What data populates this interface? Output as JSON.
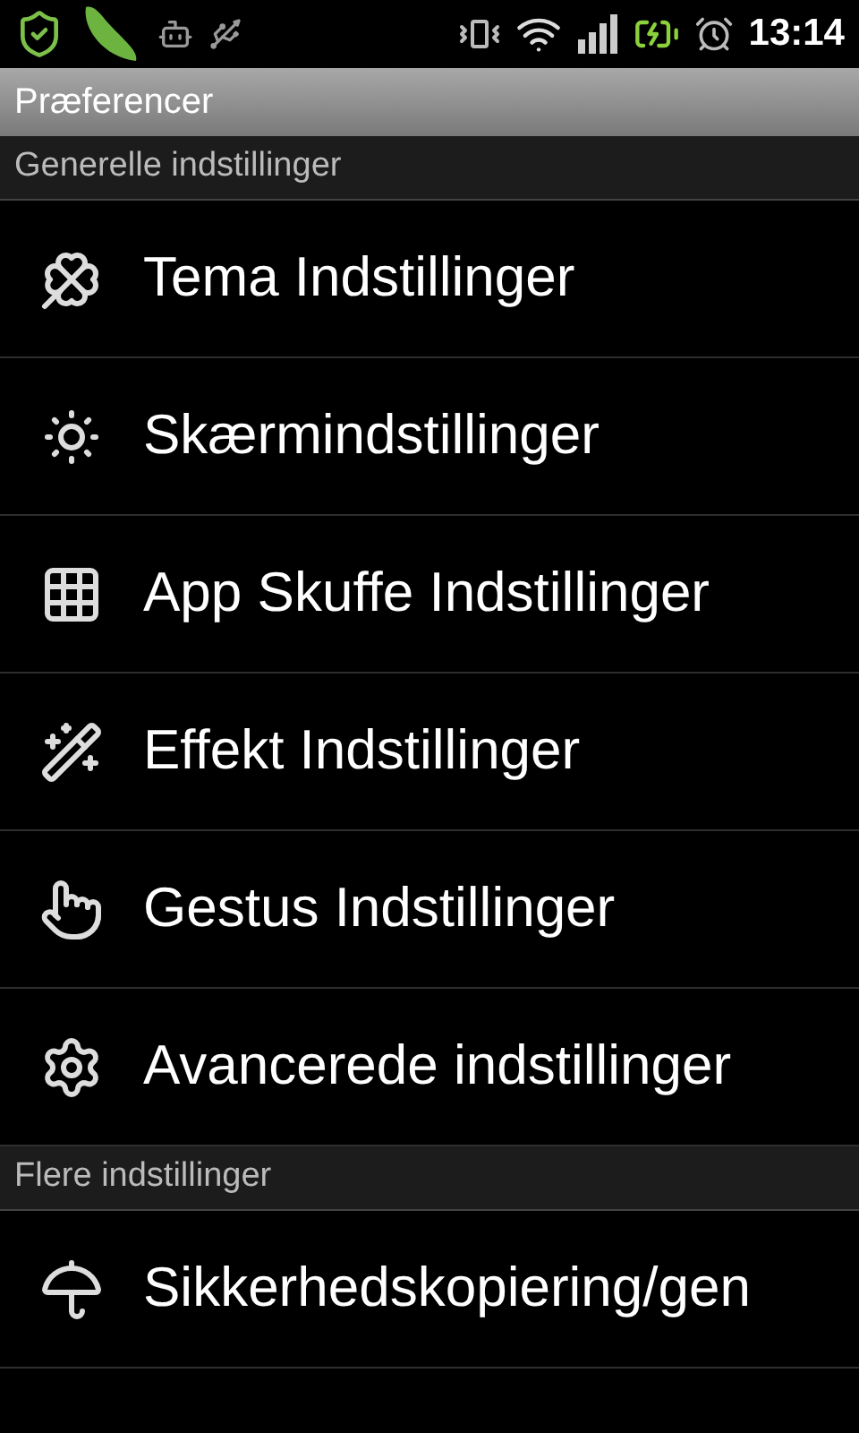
{
  "status_bar": {
    "time": "13:14"
  },
  "title": "Præferencer",
  "sections": [
    {
      "header": "Generelle indstillinger",
      "items": [
        {
          "label": "Tema Indstillinger"
        },
        {
          "label": "Skærmindstillinger"
        },
        {
          "label": "App Skuffe Indstillinger"
        },
        {
          "label": "Effekt Indstillinger"
        },
        {
          "label": "Gestus Indstillinger"
        },
        {
          "label": "Avancerede indstillinger"
        }
      ]
    },
    {
      "header": "Flere indstillinger",
      "items": [
        {
          "label": "Sikkerhedskopiering/gen"
        }
      ]
    }
  ]
}
